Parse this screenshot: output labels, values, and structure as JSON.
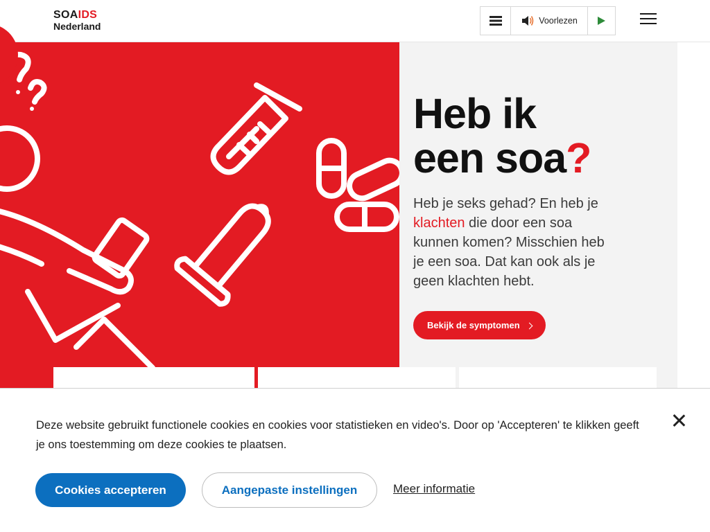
{
  "header": {
    "logo": {
      "soa": "SOA",
      "aids": "IDS",
      "name": "Nederland"
    },
    "readspeaker": {
      "read_label": "Voorlezen"
    }
  },
  "hero": {
    "title_line1": "Heb ik",
    "title_line2": "een soa",
    "title_mark": "?",
    "text_before_link": "Heb je seks gehad? En heb je ",
    "link_text": "klachten",
    "text_after_link": " die door een soa kunnen komen? Misschien heb je een soa. Dat kan ook als je geen klachten hebt.",
    "cta_label": "Bekijk de symptomen"
  },
  "cookie_banner": {
    "text": "Deze website gebruikt functionele cookies en cookies voor statistieken en video's. Door op 'Accepteren' te klikken geeft je ons toestemming om deze cookies te plaatsen.",
    "accept_label": "Cookies accepteren",
    "custom_label": "Aangepaste instellingen",
    "more_label": "Meer informatie"
  },
  "colors": {
    "brand_red": "#e31b23",
    "accent_blue": "#0c6fbf"
  },
  "icons": [
    "list-icon",
    "speaker-icon",
    "play-icon",
    "hamburger-icon",
    "close-icon",
    "chevron-right-icon"
  ]
}
